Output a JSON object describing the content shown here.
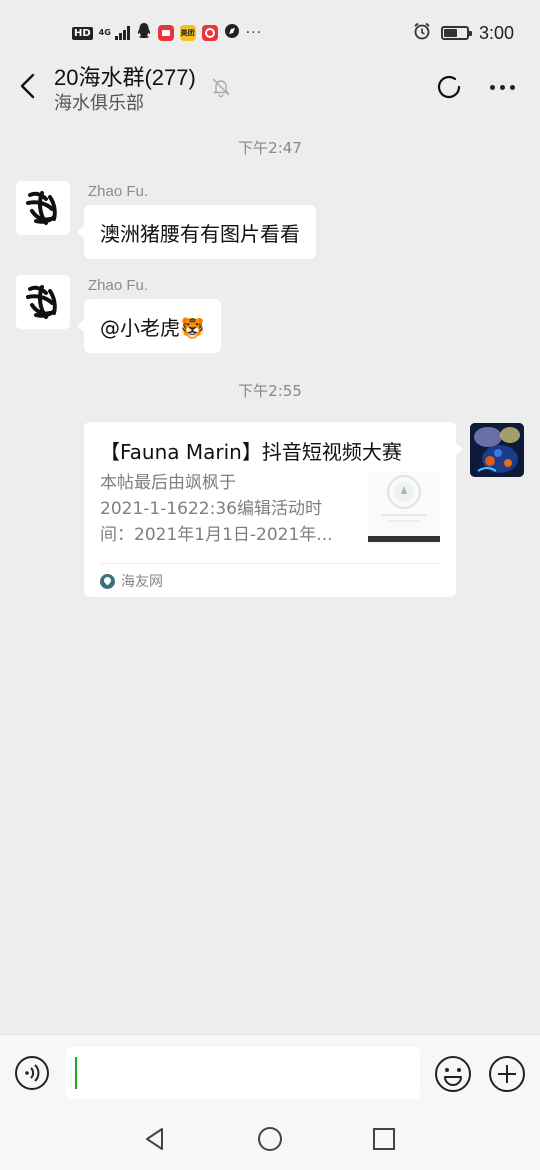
{
  "status_bar": {
    "hd_badge": "HD",
    "network": "4G",
    "app_icons": [
      {
        "name": "qq-icon",
        "color": "#222222"
      },
      {
        "name": "xiaohongshu-icon",
        "color": "#e8343a"
      },
      {
        "name": "meituan-icon",
        "color": "#f4c220"
      },
      {
        "name": "app-red-icon",
        "color": "#e8343a"
      },
      {
        "name": "compass-icon",
        "color": "#222222"
      }
    ],
    "meituan_text": "美团",
    "more_dots": "···",
    "time": "3:00",
    "battery_level": 0.55
  },
  "header": {
    "title": "20海水群(277)",
    "subtitle": "海水俱乐部"
  },
  "messages": [
    {
      "timestamp": "下午2:47",
      "sender": "Zhao Fu.",
      "text": "澳洲猪腰有有图片看看"
    },
    {
      "sender": "Zhao Fu.",
      "text": "@小老虎🐯"
    },
    {
      "timestamp": "下午2:55"
    }
  ],
  "link_card": {
    "title": "【Fauna Marin】抖音短视频大赛",
    "desc_lines": [
      "本帖最后由飒枫于",
      "2021-1-1622:36编辑活动时",
      "间：2021年1月1日-2021年..."
    ],
    "source": "海友网"
  },
  "input": {
    "value": ""
  },
  "colors": {
    "background": "#ededed",
    "bubble": "#ffffff",
    "caret": "#1aad19"
  }
}
